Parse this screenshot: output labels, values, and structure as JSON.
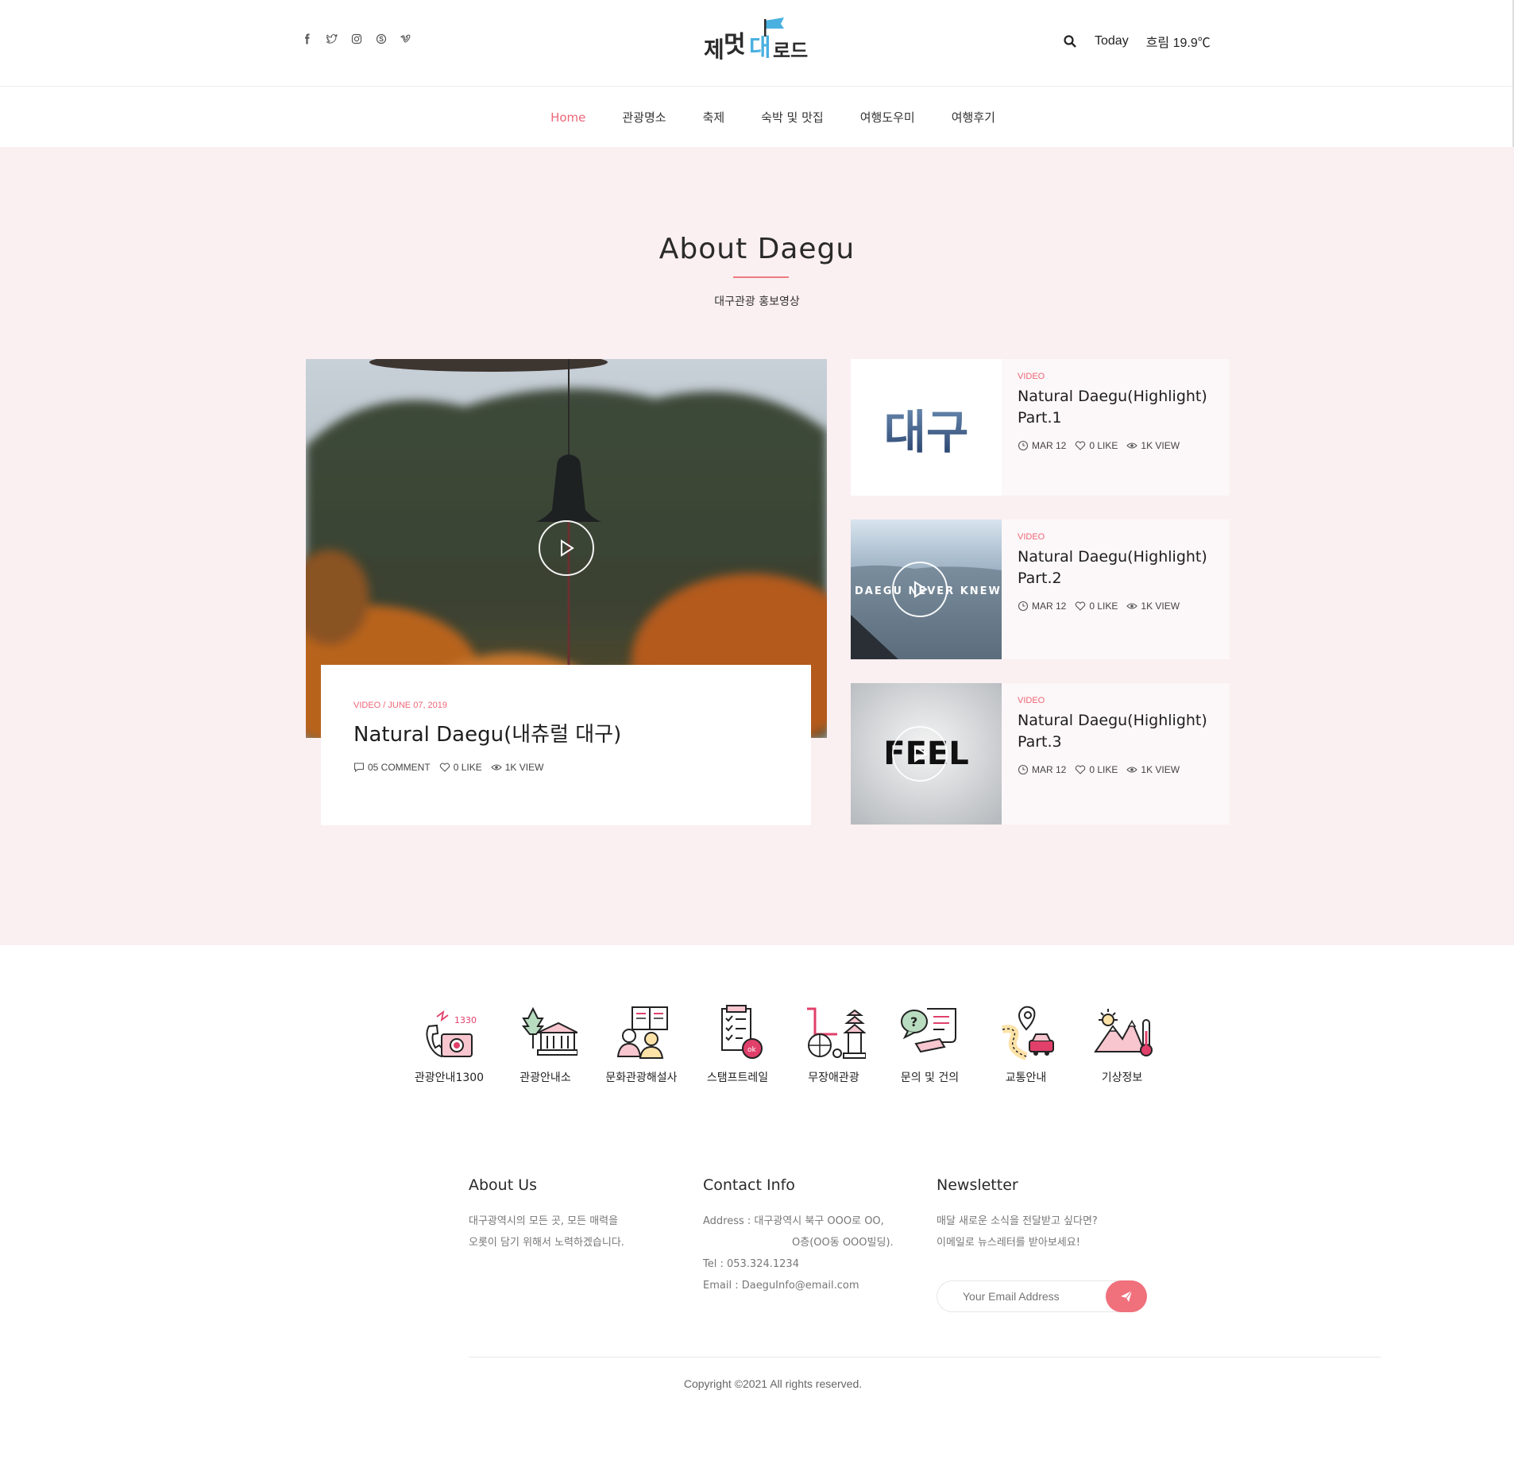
{
  "header": {
    "logo_alt": "제멋대로드",
    "logo_parts": [
      "제",
      "멋",
      "대",
      "로드"
    ],
    "today_label": "Today",
    "weather": "흐림 19.9℃",
    "social_icons": [
      "facebook-icon",
      "twitter-icon",
      "instagram-icon",
      "skype-icon",
      "vimeo-icon"
    ]
  },
  "nav": {
    "items": [
      "Home",
      "관광명소",
      "축제",
      "숙박 및 맛집",
      "여행도우미",
      "여행후기"
    ],
    "active": "Home"
  },
  "about": {
    "title": "About Daegu",
    "subtitle": "대구관광 홍보영상"
  },
  "main_video": {
    "category": "VIDEO",
    "date": "JUNE 07, 2019",
    "title": "Natural Daegu(내츄럴 대구)",
    "comments": "05 COMMENT",
    "likes": "0 LIKE",
    "views": "1K VIEW"
  },
  "side_videos": [
    {
      "category": "VIDEO",
      "title_line1": "Natural Daegu(Highlight)",
      "title_line2": "Part.1",
      "date": "MAR 12",
      "likes": "0 LIKE",
      "views": "1K VIEW",
      "thumb_text": "대구"
    },
    {
      "category": "VIDEO",
      "title_line1": "Natural Daegu(Highlight)",
      "title_line2": "Part.2",
      "date": "MAR 12",
      "likes": "0 LIKE",
      "views": "1K VIEW",
      "thumb_text": "DAEGU NEVER KNEW"
    },
    {
      "category": "VIDEO",
      "title_line1": "Natural Daegu(Highlight)",
      "title_line2": "Part.3",
      "date": "MAR 12",
      "likes": "0 LIKE",
      "views": "1K VIEW",
      "thumb_text": "FEEL"
    }
  ],
  "services": [
    {
      "label": "관광안내1300",
      "icon": "tourist-call-icon",
      "icon_text": "1330"
    },
    {
      "label": "관광안내소",
      "icon": "info-center-icon"
    },
    {
      "label": "문화관광해설사",
      "icon": "guide-icon"
    },
    {
      "label": "스탬프트레일",
      "icon": "stamp-trail-icon",
      "icon_text": "ok"
    },
    {
      "label": "무장애관광",
      "icon": "barrier-free-icon"
    },
    {
      "label": "문의 및 건의",
      "icon": "inquiry-icon",
      "icon_text": "?"
    },
    {
      "label": "교통안내",
      "icon": "traffic-icon"
    },
    {
      "label": "기상정보",
      "icon": "weather-icon"
    }
  ],
  "footer": {
    "about_title": "About Us",
    "about_line1": "대구광역시의 모든 곳, 모든 매력을",
    "about_line2": "오롯이 담기 위해서 노력하겠습니다.",
    "contact_title": "Contact Info",
    "address_line1": "Address : 대구광역시 북구 OOO로 OO,",
    "address_line2": "O층(OO동 OOO빌딩).",
    "tel": "Tel : 053.324.1234",
    "email": "Email : DaeguInfo@email.com",
    "newsletter_title": "Newsletter",
    "newsletter_line1": "매달 새로운 소식을 전달받고 싶다면?",
    "newsletter_line2": "이메일로 뉴스레터를 받아보세요!",
    "email_placeholder": "Your Email Address",
    "copyright": "Copyright ©2021 All rights reserved."
  },
  "colors": {
    "accent": "#ee6677",
    "hero_bg": "#faeff1",
    "logo_blue": "#4ab0e0"
  }
}
